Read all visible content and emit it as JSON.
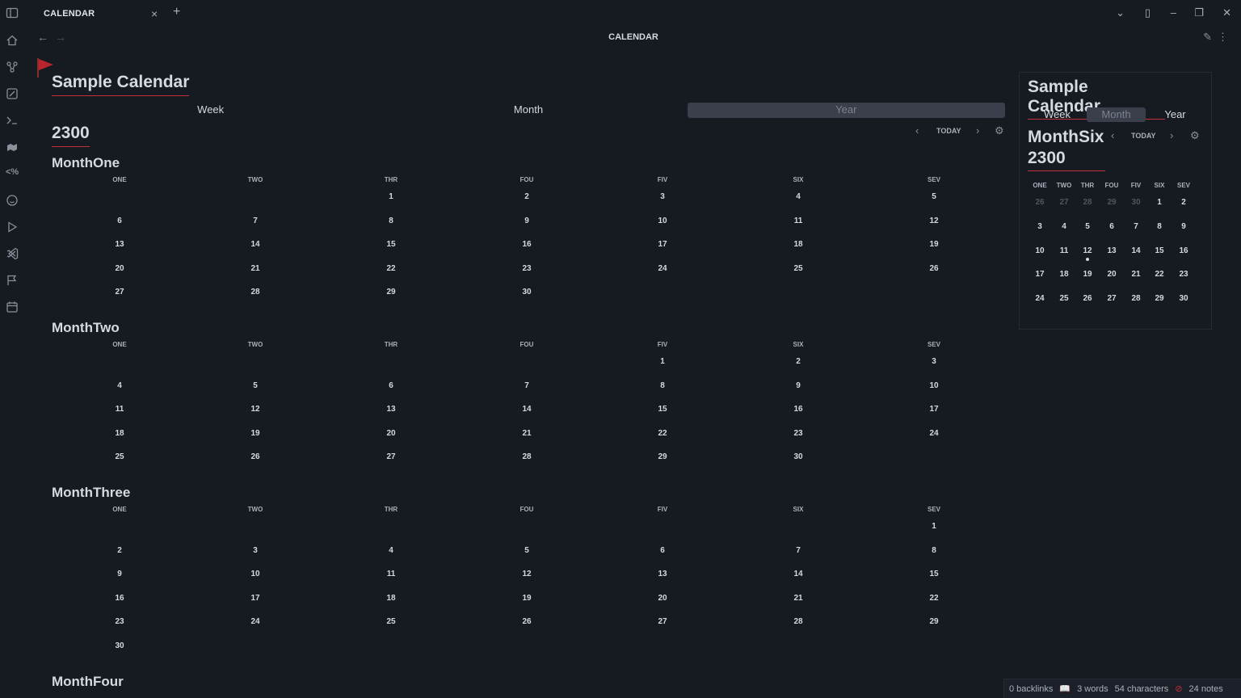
{
  "tab": {
    "title": "CALENDAR",
    "close_icon": "×",
    "new_icon": "+"
  },
  "view": {
    "title": "CALENDAR"
  },
  "calendar": {
    "title": "Sample Calendar",
    "views": [
      "Week",
      "Month",
      "Year"
    ],
    "active_view": "Year",
    "year": "2300",
    "today_label": "TODAY",
    "weekdays": [
      "ONE",
      "TWO",
      "THR",
      "FOU",
      "FIV",
      "SIX",
      "SEV"
    ],
    "months": [
      {
        "name": "MonthOne",
        "offset": 2,
        "days": 30
      },
      {
        "name": "MonthTwo",
        "offset": 4,
        "days": 30
      },
      {
        "name": "MonthThree",
        "offset": 6,
        "days": 30
      },
      {
        "name": "MonthFour",
        "offset": 1,
        "days": 0
      }
    ]
  },
  "mini": {
    "title": "Sample Calendar",
    "views": [
      "Week",
      "Month",
      "Year"
    ],
    "active_view": "Month",
    "month": "MonthSix",
    "year": "2300",
    "today_label": "TODAY",
    "weekdays": [
      "ONE",
      "TWO",
      "THR",
      "FOU",
      "FIV",
      "SIX",
      "SEV"
    ],
    "rows": [
      [
        "26",
        "27",
        "28",
        "29",
        "30",
        "1",
        "2"
      ],
      [
        "3",
        "4",
        "5",
        "6",
        "7",
        "8",
        "9"
      ],
      [
        "10",
        "11",
        "12",
        "13",
        "14",
        "15",
        "16"
      ],
      [
        "17",
        "18",
        "19",
        "20",
        "21",
        "22",
        "23"
      ],
      [
        "24",
        "25",
        "26",
        "27",
        "28",
        "29",
        "30"
      ]
    ],
    "out_of_month_count": 5,
    "current_day": "12"
  },
  "status": {
    "backlinks": "0 backlinks",
    "words": "3 words",
    "characters": "54 characters",
    "notes": "24 notes"
  },
  "colors": {
    "accent": "#c0313a",
    "bg": "#161a21"
  }
}
